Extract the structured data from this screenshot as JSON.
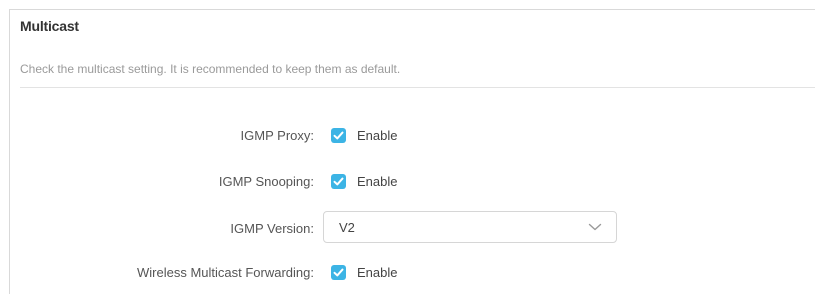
{
  "section": {
    "title": "Multicast",
    "description": "Check the multicast setting. It is recommended to keep them as default."
  },
  "settings": {
    "igmp_proxy": {
      "label": "IGMP Proxy:",
      "checkbox_label": "Enable",
      "checked": true
    },
    "igmp_snooping": {
      "label": "IGMP Snooping:",
      "checkbox_label": "Enable",
      "checked": true
    },
    "igmp_version": {
      "label": "IGMP Version:",
      "selected": "V2"
    },
    "wireless_multicast_forwarding": {
      "label": "Wireless Multicast Forwarding:",
      "checkbox_label": "Enable",
      "checked": true
    }
  },
  "colors": {
    "accent": "#3cb4e5",
    "title": "#333333",
    "description": "#9a9a9a"
  },
  "icons": {
    "checkbox": "check-icon",
    "dropdown": "chevron-down-icon"
  }
}
